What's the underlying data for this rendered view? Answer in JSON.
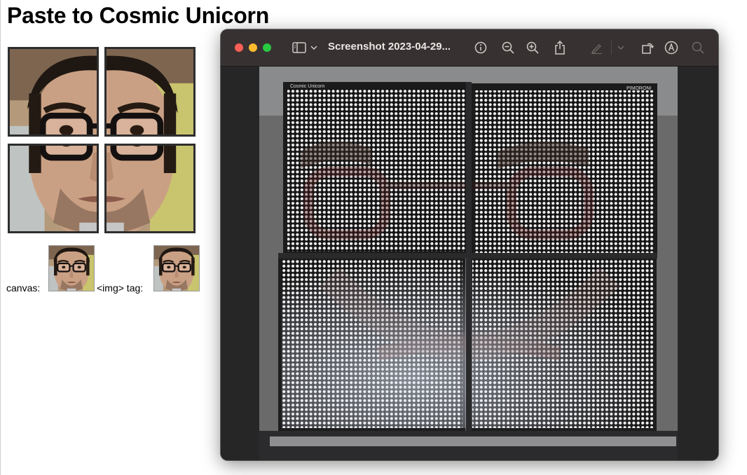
{
  "page": {
    "title": "Paste to Cosmic Unicorn",
    "canvas_label": "canvas:",
    "img_label": "<img> tag:"
  },
  "window": {
    "title": "Screenshot 2023-04-29...",
    "icons": [
      "sidebar-icon",
      "chevron-down-icon",
      "info-icon",
      "zoom-out-icon",
      "zoom-in-icon",
      "share-icon",
      "markup-pen-icon",
      "chevron-down-icon",
      "rotate-icon",
      "annotate-icon",
      "search-icon"
    ],
    "photo_labels": {
      "brand_left": "Cosmic Unicorn",
      "brand_right": "PIMORONI"
    }
  },
  "colors": {
    "titlebar": "#373231",
    "window_bg": "#262626",
    "close": "#fe5f57",
    "minimize": "#febc2e",
    "maximize": "#28c840",
    "tile_border": "#2e2e2e"
  }
}
